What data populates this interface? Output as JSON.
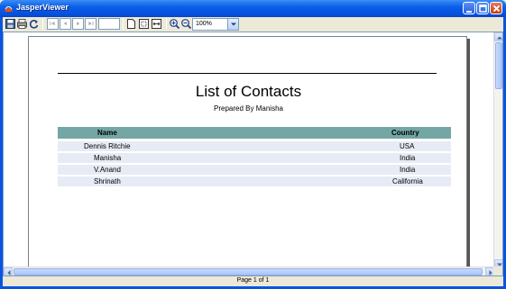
{
  "window": {
    "title": "JasperViewer"
  },
  "toolbar": {
    "zoom_value": "100%"
  },
  "report": {
    "title": "List of Contacts",
    "subtitle": "Prepared By Manisha",
    "columns": {
      "name": "Name",
      "country": "Country"
    },
    "rows": [
      {
        "name": "Dennis Ritchie",
        "country": "USA"
      },
      {
        "name": "Manisha",
        "country": "India"
      },
      {
        "name": "V.Anand",
        "country": "India"
      },
      {
        "name": "Shrinath",
        "country": "California"
      }
    ]
  },
  "status": {
    "page": "Page 1 of 1"
  },
  "colors": {
    "title_bar": "#0a5fe8",
    "header_band": "#73a6a5",
    "row_band": "#e6ebf5"
  }
}
